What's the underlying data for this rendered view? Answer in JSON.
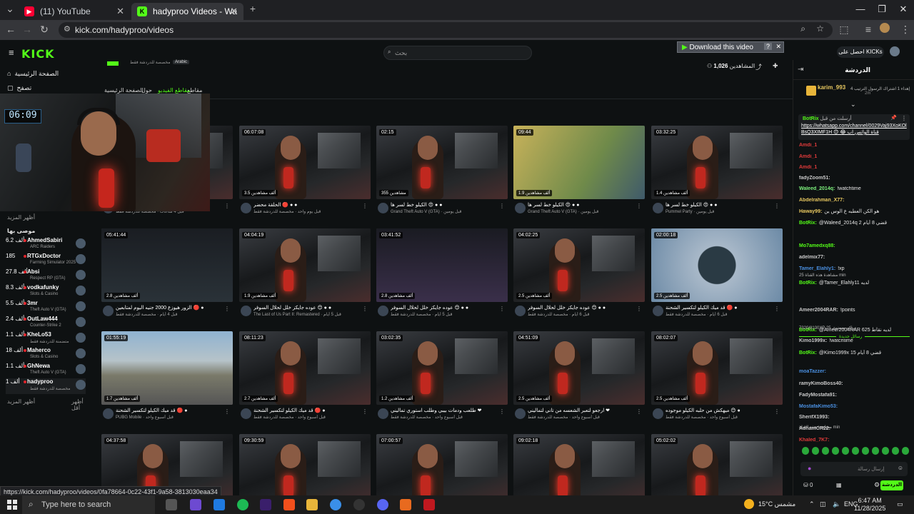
{
  "browser": {
    "tabs": [
      {
        "title": "(11) YouTube",
        "icon": "youtube-icon",
        "active": false
      },
      {
        "title": "hadyproo Videos - Watch On-D",
        "icon": "kick-icon",
        "active": true
      }
    ],
    "url": "kick.com/hadyproo/videos",
    "status_url": "https://kick.com/hadyproo/videos/0fa78664-0c22-43f1-9a58-3813030eaa34"
  },
  "header": {
    "logo": "KICK",
    "search_placeholder": "بحث",
    "download_bar": "Download this video",
    "download_help": "?",
    "get_kicks": "احصل على KICKs",
    "followers_label": "المشاهدين",
    "followers_count": "1,026"
  },
  "sidebar": {
    "nav": [
      {
        "label": "الصفحة الرئيسية",
        "icon": "home-icon"
      },
      {
        "label": "تصفح",
        "icon": "browse-icon"
      }
    ],
    "following_title": "أظهر المزيد",
    "recommended_title": "موصى بها",
    "channels": [
      {
        "count": "6.2 ألف",
        "name": "AhmedSabiri",
        "category": "ARC Raiders"
      },
      {
        "count": "185",
        "name": "RTGxDoctor",
        "category": "Farming Simulator 2025"
      },
      {
        "count": "27.8 ألف",
        "name": "Absi",
        "category": "Respect RP (GTA)"
      },
      {
        "count": "8.3 ألف",
        "name": "vodkafunky",
        "category": "Slots & Casino"
      },
      {
        "count": "5.5 ألف",
        "name": "3mr",
        "category": "Theft Auto V (GTA)"
      },
      {
        "count": "2.4 ألف",
        "name": "OutLaw444",
        "category": "Counter-Strike 2"
      },
      {
        "count": "1.1 ألف",
        "name": "KheLo53",
        "category": "متضمنة للدردشة فقط"
      },
      {
        "count": "18 ألف",
        "name": "Maherco",
        "category": "Slots & Casino"
      },
      {
        "count": "1.1 ألف",
        "name": "GhNewa",
        "category": "Theft Auto V (GTA)"
      },
      {
        "count": "1 ألف",
        "name": "hadyproo",
        "category": "مخصصة للدردشة فقط"
      }
    ],
    "show_more": "أظهر المزيد",
    "show_less": "أظهر أقل"
  },
  "channel_tabs": [
    "مقاطع",
    "مقاطع الفيديو",
    "حول",
    "الصفحة الرئيسية"
  ],
  "channel_meta": {
    "category": "مخصصة للدردشة فقط",
    "language": "Arabic"
  },
  "webcam_clock": "06:09",
  "videos": [
    {
      "duration": "",
      "views": "",
      "title": "",
      "sub": "قبل 4 ساعات · مخصصة للدردشة فقط"
    },
    {
      "duration": "06:07:08",
      "views": "3.5 ألف مشاهدين",
      "title": "الحلقة محضر 🔴 ● ●",
      "sub": "قبل يوم واحد · مخصصة للدردشة فقط"
    },
    {
      "duration": "02:15",
      "views": "355 مشاهدين",
      "title": "الكيلو خط لسر ها 😍 ● ●",
      "sub": "Grand Theft Auto V (GTA) · قبل يومين"
    },
    {
      "duration": "09:44",
      "views": "1.9 ألف مشاهدين",
      "title": "الكيلو خط لسر ها 😍 ● ●",
      "sub": "Grand Theft Auto V (GTA) · قبل يومين"
    },
    {
      "duration": "03:32:25",
      "views": "1.4 ألف مشاهدين",
      "title": "الكيلو خط لسر ها 😍 ● ●",
      "sub": "Pummel Party · قبل يومين"
    },
    {
      "duration": "05:41:44",
      "views": "2.8 ألف مشاهدين",
      "title": "الزور هيوزع 2000 جنيه اليوم لمتابعين 🔴 ●",
      "sub": "قبل 4 أيام · مخصصة للدردشة فقط"
    },
    {
      "duration": "04:04:19",
      "views": "1.9 ألف مشاهدين",
      "title": "عوده جايكز خلل لحلال السوفر 😊 ● ●",
      "sub": "The Last of Us Part II: Remastered · قبل 5 أيام"
    },
    {
      "duration": "03:41:52",
      "views": "2.8 ألف مشاهدين",
      "title": "عوده جايكز خلل لحلال السوفر 😊 ● ●",
      "sub": "قبل 5 أيام · مخصصة للدردشة فقط"
    },
    {
      "duration": "04:02:25",
      "views": "2.5 ألف مشاهدين",
      "title": "عوده جايكز خلل لحلال السوفر 😊 ● ●",
      "sub": "قبل 6 أيام · مخصصة للدردشة فقط"
    },
    {
      "duration": "02:00:18",
      "views": "2.5 ألف مشاهدين",
      "title": "قد ميك الكيلو لتكسير الشحنة 🔴 ●",
      "sub": "قبل 6 أيام · مخصصة للدردشة فقط"
    },
    {
      "duration": "01:55:19",
      "views": "1.7 ألف مشاهدين",
      "title": "قد ميك الكيلو لتكسير الشحنة 🔴 ●",
      "sub": "PUBG Mobile · قبل أسبوع واحد"
    },
    {
      "duration": "08:11:23",
      "views": "2.7 ألف مشاهدين",
      "title": "قد ميك الكيلو لتكسير الشحنة 🔴 ●",
      "sub": "قبل أسبوع واحد · مخصصة للدردشة فقط"
    },
    {
      "duration": "03:02:35",
      "views": "1.2 ألف مشاهدين",
      "title": "طلعب ودمات بيبي وطلب استوري تماليني ❤",
      "sub": "قبل أسبوع واحد · مخصصة للدردشة فقط"
    },
    {
      "duration": "04:51:09",
      "views": "2.5 ألف مشاهدين",
      "title": "ارجعو لتعبر الشعسه من تاني لتماليني ❤",
      "sub": "قبل أسبوع واحد · مخصصة للدردشة فقط"
    },
    {
      "duration": "08:02:07",
      "views": "2.5 ألف مشاهدين",
      "title": "ميهكش من حلبه الكيلو موجوده 😊 ●",
      "sub": "قبل أسبوع واحد · مخصصة للدردشة فقط"
    },
    {
      "duration": "04:37:58",
      "views": "",
      "title": "",
      "sub": ""
    },
    {
      "duration": "09:30:59",
      "views": "",
      "title": "",
      "sub": ""
    },
    {
      "duration": "07:00:57",
      "views": "",
      "title": "",
      "sub": ""
    },
    {
      "duration": "09:02:18",
      "views": "",
      "title": "",
      "sub": ""
    },
    {
      "duration": "05:02:02",
      "views": "",
      "title": "",
      "sub": ""
    }
  ],
  "chat": {
    "title": "الدردشة",
    "top_user": "karim_993",
    "top_user_sub": "إهداء 1 اشتراك الرسول الترتيب 4",
    "top_user_time": "2m",
    "pinned_by": "BotRix",
    "pinned_label": "أرسلت من قبل",
    "pinned_link": "https://whatsapp.com/channel/0029Vaj93XoKOlBsQ3XIMF1H 😊 😂 قناة الواتس اب",
    "messages": [
      {
        "user": "Amdi_1",
        "text": "",
        "color": "#e03a3a"
      },
      {
        "user": "Amdi_1",
        "text": "",
        "color": "#e03a3a"
      },
      {
        "user": "Amdi_1",
        "text": "",
        "color": "#e03a3a"
      },
      {
        "user": "fadyZoom51:",
        "text": "",
        "color": "#c9c9c9"
      },
      {
        "user": "Waleed_2014q:",
        "text": "!watchtime",
        "color": "#7cf07c"
      },
      {
        "user": "Abdelrahman_X77:",
        "text": "",
        "color": "#e8c860"
      },
      {
        "user": "Haway99:",
        "text": "هو الكن العطبه ع الوس ين",
        "color": "#e8c860"
      },
      {
        "user": "BotRix:",
        "text": "@Waleed_2014q 2 قضي 8 أيام",
        "color": "#53fc18"
      },
      {
        "user": "Mo7amedxq88:",
        "text": "",
        "color": "#53fc18"
      },
      {
        "user": "adelmix77:",
        "text": "",
        "color": "#c9c9c9"
      },
      {
        "user": "Tamer_Elahly1:",
        "text": "!xp",
        "color": "#4a90e2"
      },
      {
        "user": "BotRix:",
        "text": "@Tamer_Elahly11 لديه",
        "color": "#53fc18"
      },
      {
        "user": "Ameer2004RAR:",
        "text": "!points",
        "color": "#c9c9c9"
      },
      {
        "user": "BotRix:",
        "text": "@Ameer2004RAR 625 لديه نقاط",
        "color": "#53fc18"
      },
      {
        "user": "Kimo1999x:",
        "text": "!watchtime",
        "color": "#c9c9c9"
      },
      {
        "user": "BotRix:",
        "text": "@Kimo1999x 15 قضي 8 أيام",
        "color": "#53fc18"
      },
      {
        "user": "moaTazzer:",
        "text": "",
        "color": "#4a90e2"
      },
      {
        "user": "ramyKimoBoss40:",
        "text": "",
        "color": "#c9c9c9"
      },
      {
        "user": "FadyMostafa91:",
        "text": "",
        "color": "#c9c9c9"
      },
      {
        "user": "MostafaKimo53:",
        "text": "",
        "color": "#4a90e2"
      },
      {
        "user": "SherifX1993:",
        "text": "",
        "color": "#c9c9c9"
      },
      {
        "user": "AdhamCR22:",
        "text": "",
        "color": "#c9c9c9"
      },
      {
        "user": "Khaled_7K7:",
        "text": "",
        "color": "#e03a3a"
      }
    ],
    "sys_lines": [
      "مشاهدة هذه القناة 25 min",
      "7320/8100XP تراكم مستوى 25",
      "رسائل جديدة",
      "مشاهدة هذه القناة min"
    ],
    "input_placeholder": "إرسال رسالة",
    "send_label": "الدردشة",
    "kicks_count": "0"
  },
  "taskbar": {
    "search_placeholder": "Type here to search",
    "weather": "15°C مشمس",
    "lang": "ENG",
    "time": "6:47 AM",
    "date": "11/28/2025"
  }
}
